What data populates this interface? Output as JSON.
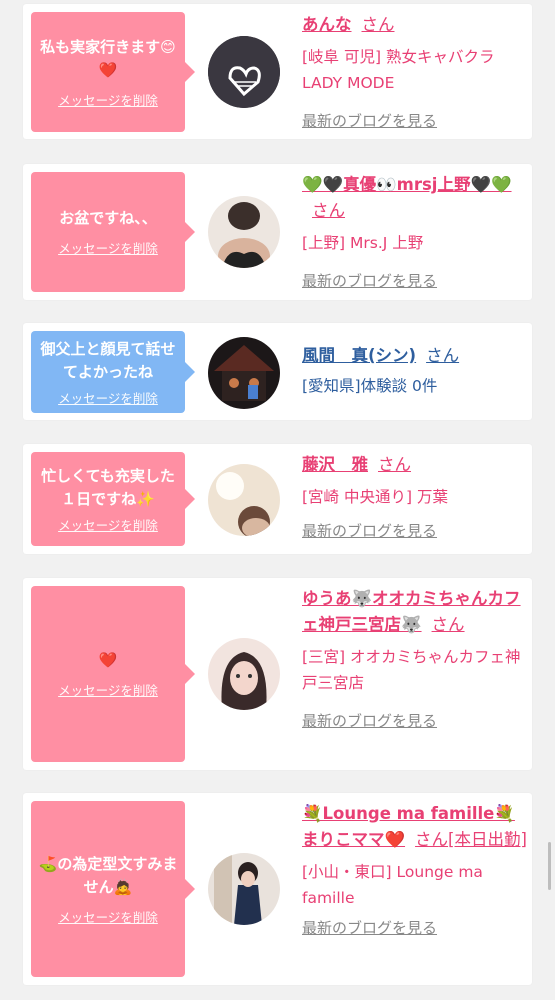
{
  "delete_label": "メッセージを削除",
  "blog_label": "最新のブログを見る",
  "san": "さん",
  "cards": [
    {
      "message": "私も実家行きます😊❤️",
      "name": "あんな",
      "shop": "[岐阜 可児] 熟女キャバクラ LADY MODE",
      "blog": true,
      "color": "pink"
    },
    {
      "message": "お盆ですね、、",
      "name": "💚🖤真優👀mrsj上野🖤💚",
      "shop": "[上野] Mrs.J 上野",
      "blog": true,
      "color": "pink"
    },
    {
      "message": "御父上と顔見て話せてよかったね",
      "name": "風間　真(シン)",
      "shop": "[愛知県]体験談 0件",
      "blog": false,
      "color": "blue"
    },
    {
      "message": "忙しくても充実した１日ですね✨",
      "name": "藤沢　雅",
      "shop": "[宮崎 中央通り] 万葉",
      "blog": true,
      "color": "pink"
    },
    {
      "message": "❤️",
      "name": "ゆうあ🐺オオカミちゃんカフェ神戸三宮店🐺",
      "shop": "[三宮] オオカミちゃんカフェ神戸三宮店",
      "blog": true,
      "color": "pink"
    },
    {
      "message": "⛳の為定型文すみません🙇",
      "name": "💐Lounge ma famille💐まりこママ❤️",
      "san_suffix": "[本日出勤]",
      "shop": "[小山・東口] Lounge ma famille",
      "blog": true,
      "color": "pink"
    }
  ]
}
